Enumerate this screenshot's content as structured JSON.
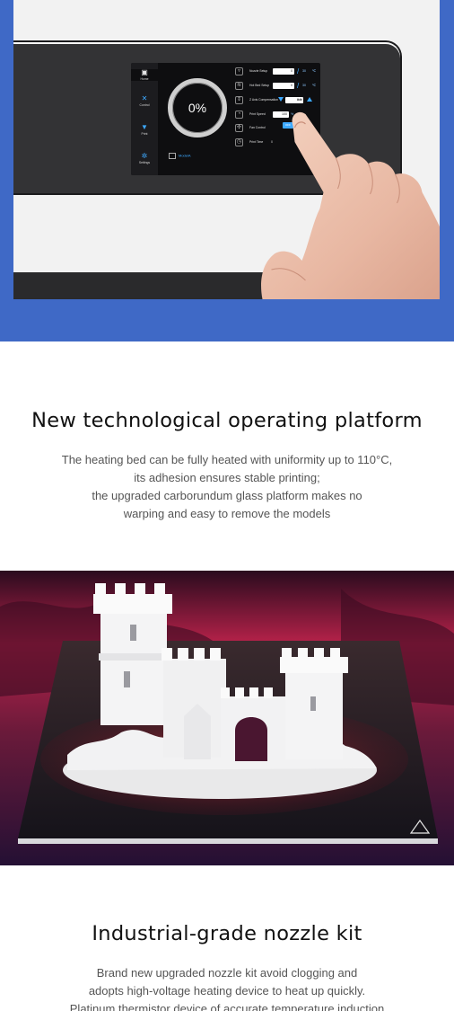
{
  "screen": {
    "progress_text": "0%",
    "nav": {
      "home": "Home",
      "control": "Control",
      "print": "Print",
      "settings": "Settings"
    },
    "settings": [
      {
        "label": "Nozzle Setup",
        "value": "0",
        "target": "30",
        "unit": "℃"
      },
      {
        "label": "Hot Bed Setup",
        "value": "0",
        "target": "30",
        "unit": "℃"
      },
      {
        "label": "Z Axis Compensation",
        "value": "0.0",
        "unit": "mm"
      },
      {
        "label": "Print Speed",
        "value": "100",
        "unit": "%"
      },
      {
        "label": "Fan Control",
        "toggle": "OFF"
      },
      {
        "label": "Print Time",
        "value": "0"
      }
    ],
    "model_file": "ModelA",
    "accent_color": "#3da9ff"
  },
  "section1": {
    "title": "New technological operating platform",
    "lines": [
      "The heating bed can be fully heated with uniformity up to 110°C,",
      "its adhesion ensures stable printing;",
      "the upgraded carborundum glass platform makes no",
      "warping and easy to remove the models"
    ]
  },
  "section2": {
    "title": "Industrial-grade nozzle kit",
    "lines": [
      "Brand new upgraded nozzle kit avoid clogging and",
      "adopts high-voltage heating device to heat up quickly.",
      "Platinum thermistor device of accurate temperature induction"
    ]
  },
  "colors": {
    "band_blue": "#3f69c6",
    "heading": "#111111",
    "body_text": "#555555"
  }
}
